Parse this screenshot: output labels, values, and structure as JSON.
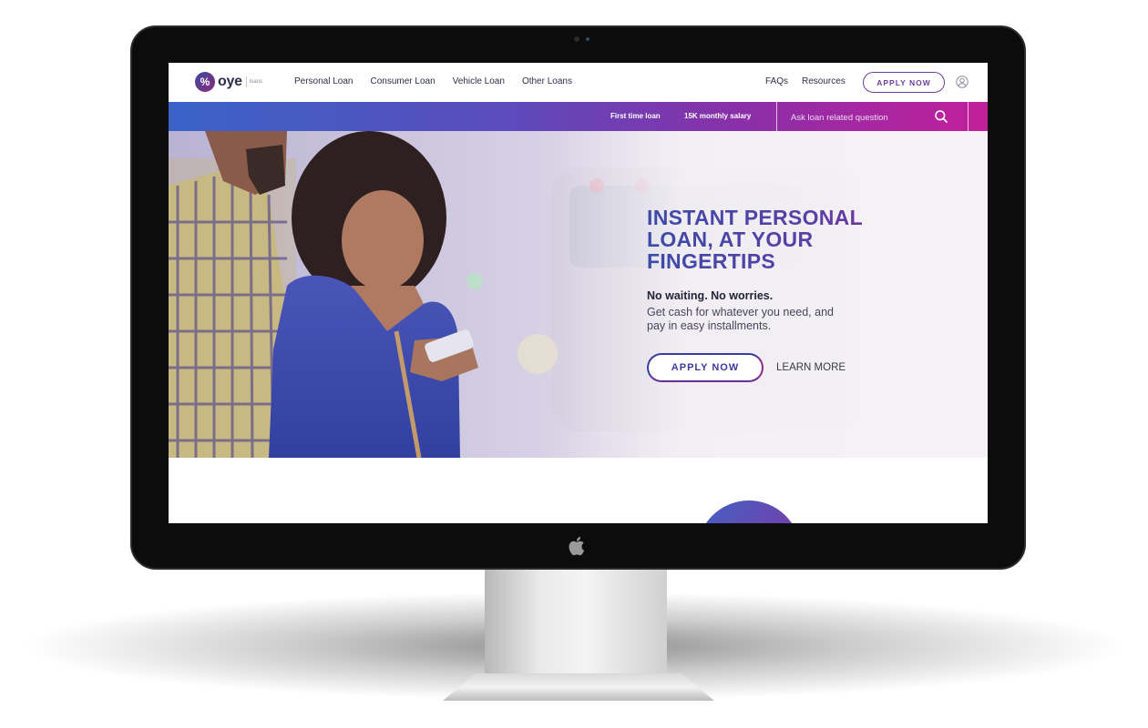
{
  "nav": {
    "logo_mark": "%",
    "logo_text": "oye",
    "logo_sub": "loans",
    "links": [
      "Personal Loan",
      "Consumer Loan",
      "Vehicle Loan",
      "Other Loans"
    ],
    "right_links": [
      "FAQs",
      "Resources"
    ],
    "apply_label": "APPLY NOW"
  },
  "subbar": {
    "chips": [
      "First time loan",
      "15K monthly salary"
    ],
    "search_placeholder": "Ask loan related question"
  },
  "hero": {
    "title": "INSTANT PERSONAL LOAN, AT YOUR FINGERTIPS",
    "tagline": "No waiting. No worries.",
    "description": "Get cash for whatever you need, and pay in easy installments.",
    "apply_label": "APPLY NOW",
    "learn_more_label": "LEARN MORE"
  },
  "colors": {
    "brand_blue": "#3a63c8",
    "brand_purple": "#6b3fa0",
    "brand_magenta": "#c21f9a",
    "text_dark": "#2b2f4a"
  },
  "icons": {
    "search": "search-icon",
    "user": "user-icon",
    "apple": "apple-logo-icon"
  }
}
